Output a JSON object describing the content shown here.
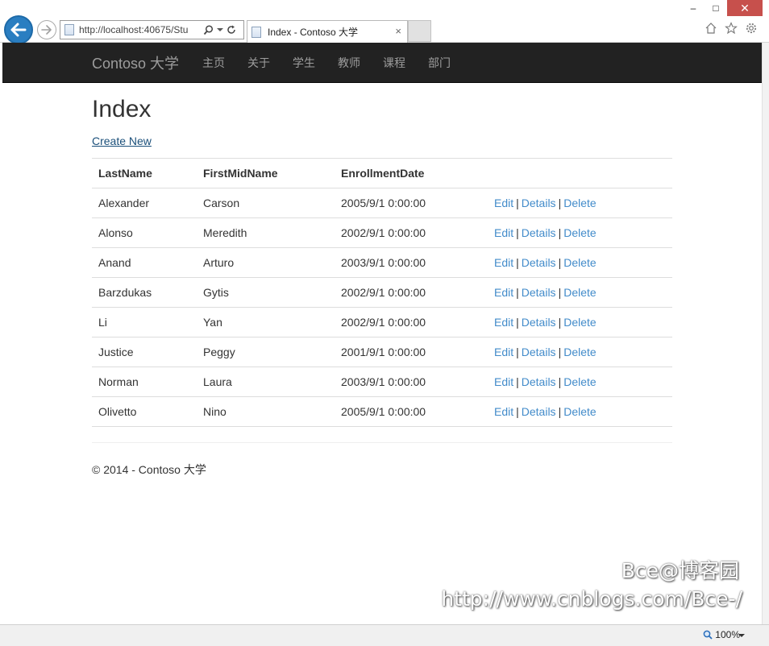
{
  "browser": {
    "url": "http://localhost:40675/Stu",
    "tab_title": "Index - Contoso 大学",
    "tab_close": "×",
    "win_minimize": "–",
    "win_maximize": "□",
    "win_close": "✕",
    "zoom": "100%"
  },
  "navbar": {
    "brand": "Contoso 大学",
    "links": [
      "主页",
      "关于",
      "学生",
      "教师",
      "课程",
      "部门"
    ]
  },
  "page": {
    "title": "Index",
    "create_new": "Create New"
  },
  "table": {
    "headers": [
      "LastName",
      "FirstMidName",
      "EnrollmentDate"
    ],
    "actions": {
      "edit": "Edit",
      "details": "Details",
      "delete": "Delete",
      "separator": "|"
    },
    "rows": [
      {
        "last": "Alexander",
        "first": "Carson",
        "date": "2005/9/1 0:00:00"
      },
      {
        "last": "Alonso",
        "first": "Meredith",
        "date": "2002/9/1 0:00:00"
      },
      {
        "last": "Anand",
        "first": "Arturo",
        "date": "2003/9/1 0:00:00"
      },
      {
        "last": "Barzdukas",
        "first": "Gytis",
        "date": "2002/9/1 0:00:00"
      },
      {
        "last": "Li",
        "first": "Yan",
        "date": "2002/9/1 0:00:00"
      },
      {
        "last": "Justice",
        "first": "Peggy",
        "date": "2001/9/1 0:00:00"
      },
      {
        "last": "Norman",
        "first": "Laura",
        "date": "2003/9/1 0:00:00"
      },
      {
        "last": "Olivetto",
        "first": "Nino",
        "date": "2005/9/1 0:00:00"
      }
    ]
  },
  "footer": {
    "text": "© 2014 - Contoso 大学"
  },
  "watermark": {
    "line1": "Bce@博客园",
    "line2": "http://www.cnblogs.com/Bce-/"
  },
  "colors": {
    "navbar_bg": "#222222",
    "link": "#428bca",
    "back_button": "#2a7ec1",
    "close_button": "#c7504c"
  }
}
